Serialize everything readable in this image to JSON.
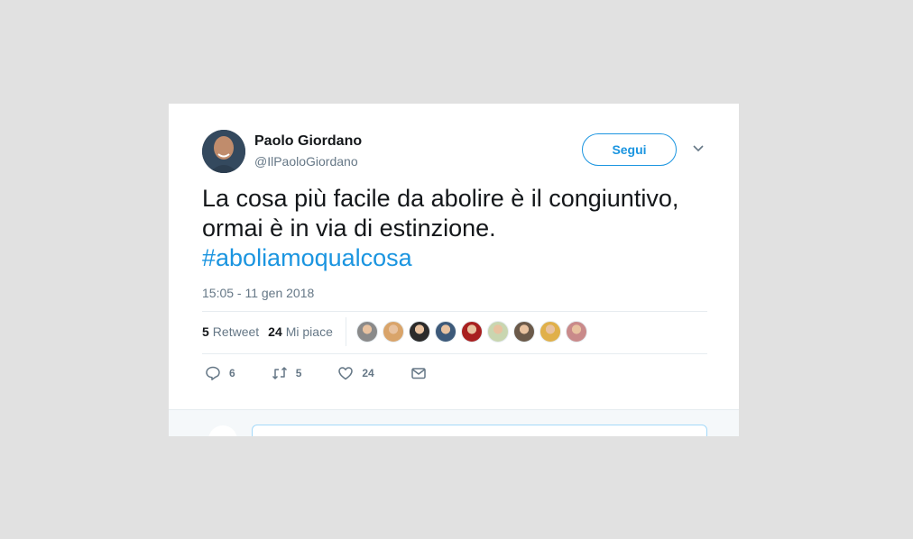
{
  "author": {
    "name": "Paolo Giordano",
    "handle": "@IlPaoloGiordano"
  },
  "follow_label": "Segui",
  "tweet": {
    "line1": "La cosa più facile da abolire è il congiuntivo,",
    "line2": "ormai è in via di estinzione.",
    "hashtag": "#aboliamoqualcosa"
  },
  "timestamp": "15:05 - 11 gen 2018",
  "stats": {
    "retweets_count": "5",
    "retweets_label": "Retweet",
    "likes_count": "24",
    "likes_label": "Mi piace"
  },
  "liker_colors": [
    "#8a8a8a",
    "#d9a46a",
    "#2b2b2b",
    "#3d5a7a",
    "#a82020",
    "#c9d6b0",
    "#6b5a4a",
    "#e0b04a",
    "#c98a8a"
  ],
  "actions": {
    "replies": "6",
    "retweets": "5",
    "likes": "24"
  },
  "colors": {
    "accent": "#1b95e0",
    "text": "#14171a",
    "muted": "#657786",
    "background": "#e1e1e1"
  }
}
